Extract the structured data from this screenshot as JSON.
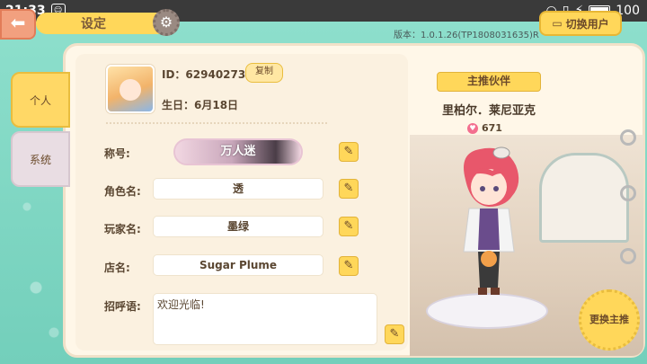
{
  "status_bar": {
    "time": "21:33",
    "battery": "100"
  },
  "header": {
    "title": "设定",
    "version": "版本：1.0.1.26(TP1808031635)R",
    "switch_user": "切换用户"
  },
  "tabs": [
    {
      "label": "个人",
      "active": true
    },
    {
      "label": "系统",
      "active": false
    }
  ],
  "profile": {
    "id_text": "ID：62940273",
    "copy_label": "复制",
    "birthday_text": "生日：6月18日",
    "title_label": "称号:",
    "title_value": "万人迷",
    "role_label": "角色名:",
    "role_value": "透",
    "player_label": "玩家名:",
    "player_value": "墨绿",
    "shop_label": "店名:",
    "shop_value": "Sugar Plume",
    "greeting_label": "招呼语:",
    "greeting_value": "欢迎光临!"
  },
  "partner": {
    "banner": "主推伙伴",
    "name": "里柏尔．莱尼亚克",
    "affection": "671",
    "change_label": "更换主推"
  },
  "colors": {
    "accent": "#ffd75a",
    "background": "#7fd6c4",
    "panel": "#fff7e8"
  }
}
